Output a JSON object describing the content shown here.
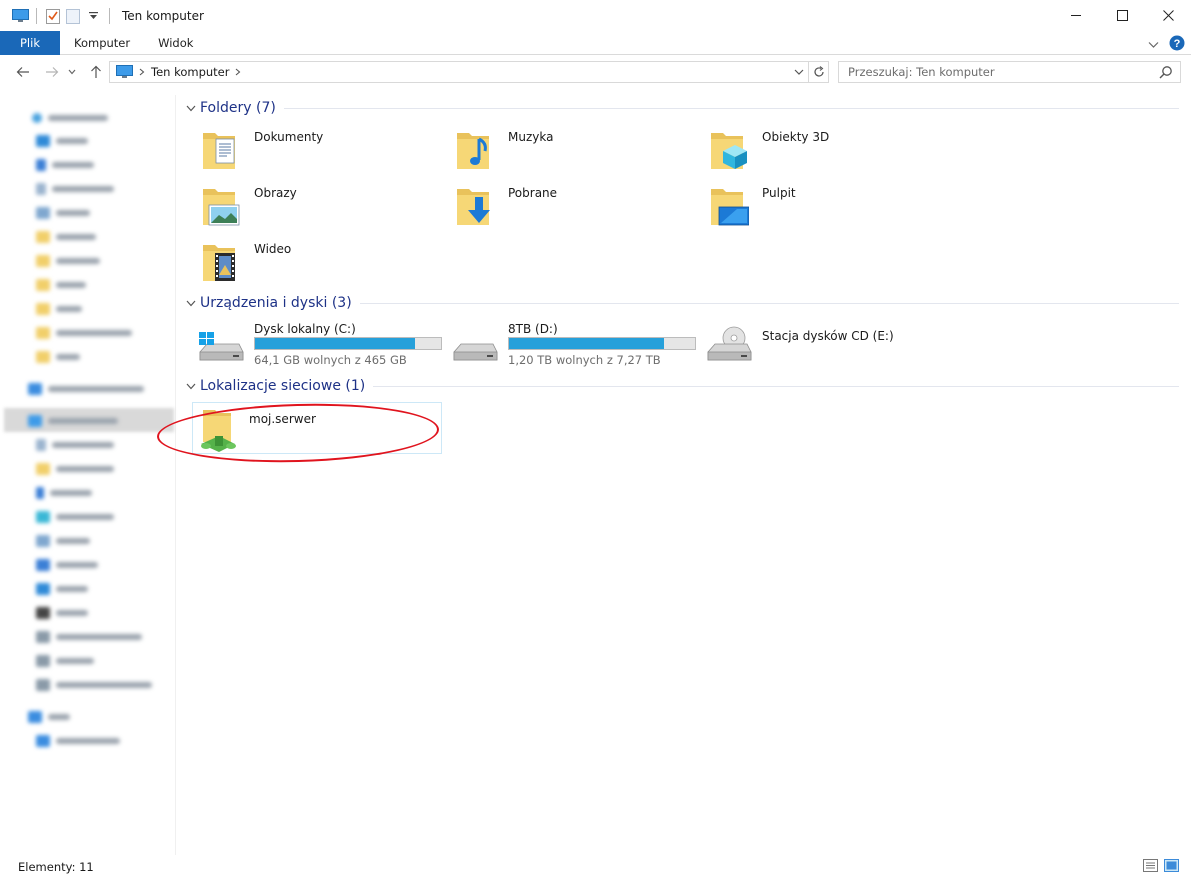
{
  "window": {
    "title": "Ten komputer"
  },
  "ribbon": {
    "tabs": [
      {
        "label": "Plik"
      },
      {
        "label": "Komputer"
      },
      {
        "label": "Widok"
      }
    ]
  },
  "address": {
    "crumb": "Ten komputer",
    "search_placeholder": "Przeszukaj: Ten komputer"
  },
  "groups": {
    "folders": {
      "title": "Foldery (7)",
      "items": [
        {
          "name": "Dokumenty",
          "icon": "documents-folder-icon"
        },
        {
          "name": "Muzyka",
          "icon": "music-folder-icon"
        },
        {
          "name": "Obiekty 3D",
          "icon": "3d-objects-folder-icon"
        },
        {
          "name": "Obrazy",
          "icon": "pictures-folder-icon"
        },
        {
          "name": "Pobrane",
          "icon": "downloads-folder-icon"
        },
        {
          "name": "Pulpit",
          "icon": "desktop-folder-icon"
        },
        {
          "name": "Wideo",
          "icon": "videos-folder-icon"
        }
      ]
    },
    "devices": {
      "title": "Urządzenia i dyski (3)",
      "items": [
        {
          "name": "Dysk lokalny (C:)",
          "free": "64,1 GB wolnych z 465 GB",
          "used_fraction": 0.862
        },
        {
          "name": "8TB (D:)",
          "free": "1,20 TB wolnych z 7,27 TB",
          "used_fraction": 0.835
        },
        {
          "name": "Stacja dysków CD (E:)"
        }
      ]
    },
    "network": {
      "title": "Lokalizacje sieciowe (1)",
      "items": [
        {
          "name": "moj.serwer",
          "icon": "network-folder-icon"
        }
      ]
    }
  },
  "status": {
    "count": "Elementy: 11"
  },
  "colors": {
    "accent": "#1a68b8",
    "group_title": "#1e3287",
    "drive_fill": "#26a0da",
    "highlight_ellipse": "#e0141e"
  }
}
